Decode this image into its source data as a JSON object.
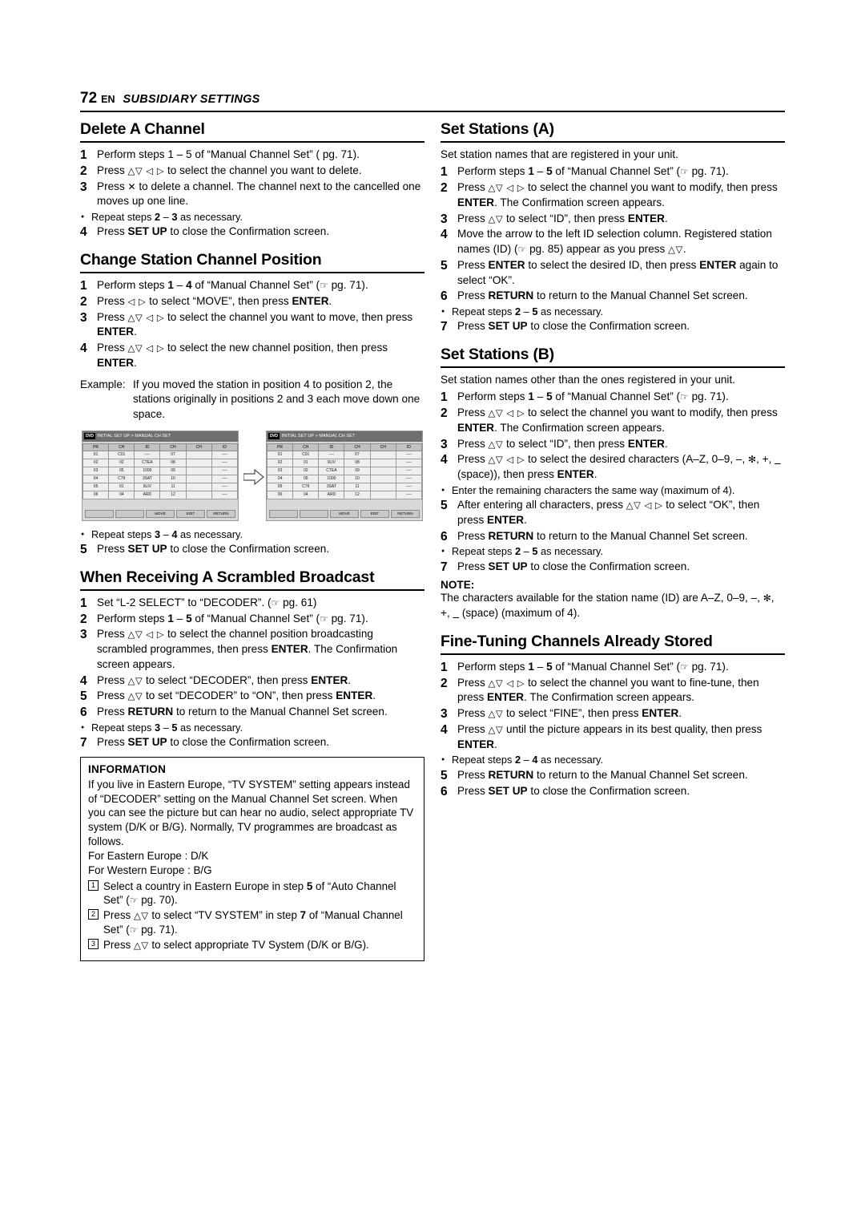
{
  "header": {
    "page_number": "72",
    "lang": "EN",
    "section": "SUBSIDIARY SETTINGS"
  },
  "left": {
    "s1": {
      "title": "Delete A Channel",
      "steps": [
        "Perform steps 1 – 5 of “Manual Channel Set” ( pg. 71).",
        "Press     to select the channel you want to delete.",
        "Press  to delete a channel. The channel next to the cancelled one moves up one line.",
        "Press SET UP to close the Confirmation screen."
      ],
      "bullet": "Repeat steps 2 – 3 as necessary."
    },
    "s2": {
      "title": "Change Station Channel Position",
      "steps": [
        "Perform steps 1 – 4 of “Manual Channel Set” ( pg. 71).",
        "Press    to select “MOVE”, then press ENTER.",
        "Press      to select the channel you want to move, then press ENTER.",
        "Press      to select the new channel position, then press ENTER."
      ],
      "example_label": "Example:",
      "example_text": "If you moved the station in position 4 to position 2, the stations originally in positions 2 and 3 each move down one space.",
      "bullet": "Repeat steps 3 – 4 as necessary.",
      "last_step": "Press SET UP to close the Confirmation screen.",
      "last_step_num": "5"
    },
    "s3": {
      "title": "When Receiving A Scrambled Broadcast",
      "steps": [
        "Set “L-2 SELECT” to “DECODER”. ( pg. 61)",
        "Perform steps 1 – 5 of “Manual Channel Set” ( pg. 71).",
        "Press      to select the channel position broadcasting scrambled programmes, then press ENTER. The Confirmation screen appears.",
        "Press    to select “DECODER”, then press ENTER.",
        "Press    to set “DECODER” to “ON”, then press ENTER.",
        "Press RETURN to return to the Manual Channel Set screen."
      ],
      "bullet": "Repeat steps 3 – 5 as necessary.",
      "last_step": "Press SET UP to close the Confirmation screen.",
      "last_step_num": "7"
    },
    "info": {
      "title": "INFORMATION",
      "body": "If you live in Eastern Europe, “TV SYSTEM” setting appears instead of “DECODER” setting on the Manual Channel Set screen. When you can see the picture but can hear no audio, select appropriate TV system (D/K or B/G). Normally, TV programmes are broadcast as follows.",
      "line_east": "For Eastern Europe : D/K",
      "line_west": "For Western Europe : B/G",
      "numbered": [
        "Select a country in Eastern Europe in step 5 of “Auto Channel Set” ( pg. 70).",
        "Press    to select “TV SYSTEM” in step 7 of “Manual Channel Set” ( pg. 71).",
        "Press    to select appropriate TV System (D/K or B/G)."
      ]
    },
    "figure": {
      "screen1": {
        "logo": "DVD",
        "title": "INITIAL SET UP > MANUAL CH SET",
        "headers": [
          "PR",
          "CH",
          "ID",
          "CH",
          "CH",
          "ID"
        ],
        "rows": [
          [
            "01",
            "C01",
            "----",
            "07",
            "",
            "----"
          ],
          [
            "02",
            "02",
            "CTEA",
            "08",
            "",
            "----"
          ],
          [
            "03",
            "05",
            "1000",
            "09",
            "",
            "----"
          ],
          [
            "04",
            "C79",
            "3SAT",
            "10",
            "",
            "----"
          ],
          [
            "05",
            "01",
            "9LIV",
            "11",
            "",
            "----"
          ],
          [
            "06",
            "04",
            "ARD",
            "12",
            "",
            "----"
          ]
        ],
        "buttons": [
          "",
          "",
          "MOVE",
          "EDIT",
          "RETURN"
        ]
      },
      "screen2": {
        "logo": "DVD",
        "title": "INITIAL SET UP > MANUAL CH SET",
        "headers": [
          "PR",
          "CH",
          "ID",
          "CH",
          "CH",
          "ID"
        ],
        "rows": [
          [
            "01",
            "C01",
            "----",
            "07",
            "",
            "----"
          ],
          [
            "02",
            "01",
            "9LIV",
            "08",
            "",
            "----"
          ],
          [
            "03",
            "02",
            "CTEA",
            "09",
            "",
            "----"
          ],
          [
            "04",
            "05",
            "1000",
            "10",
            "",
            "----"
          ],
          [
            "05",
            "C79",
            "3SAT",
            "11",
            "",
            "----"
          ],
          [
            "06",
            "04",
            "ARD",
            "12",
            "",
            "----"
          ]
        ],
        "buttons": [
          "",
          "",
          "MOVE",
          "EDIT",
          "RETURN"
        ]
      }
    }
  },
  "right": {
    "s1": {
      "title": "Set Stations (A)",
      "intro": "Set station names that are registered in your unit.",
      "steps": [
        "Perform steps 1 – 5 of “Manual Channel Set” ( pg. 71).",
        "Press      to select the channel you want to modify, then press ENTER. The Confirmation screen appears.",
        "Press    to select “ID”, then press ENTER.",
        "Move the arrow to the left ID selection column. Registered station names (ID) ( pg. 85) appear as you press   .",
        "Press ENTER to select the desired ID, then press ENTER again to select “OK”.",
        "Press RETURN to return to the Manual Channel Set screen."
      ],
      "bullet": "Repeat steps 2 – 5 as necessary.",
      "last_step": "Press SET UP to close the Confirmation screen.",
      "last_step_num": "7"
    },
    "s2": {
      "title": "Set Stations (B)",
      "intro": "Set station names other than the ones registered in your unit.",
      "steps": [
        "Perform steps 1 – 5 of “Manual Channel Set” ( pg. 71).",
        "Press      to select the channel you want to modify, then press ENTER. The Confirmation screen appears.",
        "Press    to select “ID”, then press ENTER.",
        "Press      to select the desired characters (A–Z, 0–9, –, , +,  (space)), then press ENTER.",
        "After entering all characters, press      to select “OK”, then press ENTER.",
        "Press RETURN to return to the Manual Channel Set screen."
      ],
      "bullet_mid": "Enter the remaining characters the same way (maximum of 4).",
      "bullet": "Repeat steps 2 – 5 as necessary.",
      "last_step": "Press SET UP to close the Confirmation screen.",
      "last_step_num": "7",
      "note_head": "NOTE:",
      "note_body": "The characters available for the station name (ID) are A–Z, 0–9, –, , +,  (space) (maximum of 4)."
    },
    "s3": {
      "title": "Fine-Tuning Channels Already Stored",
      "steps": [
        "Perform steps 1 – 5 of “Manual Channel Set” ( pg. 71).",
        "Press      to select the channel you want to fine-tune, then press ENTER. The Confirmation screen appears.",
        "Press    to select “FINE”, then press ENTER.",
        "Press    until the picture appears in its best quality, then press ENTER."
      ],
      "bullet": "Repeat steps 2 – 4 as necessary.",
      "step5": "Press RETURN to return to the Manual Channel Set screen.",
      "step6": "Press SET UP to close the Confirmation screen."
    }
  }
}
